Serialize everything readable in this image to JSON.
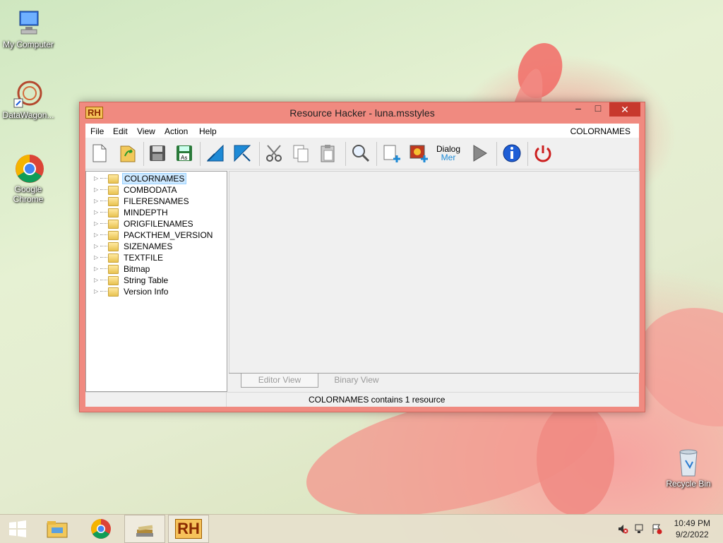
{
  "desktop": {
    "icons": [
      {
        "label": "My Computer"
      },
      {
        "label": "DataWagon..."
      },
      {
        "label": "Google Chrome"
      },
      {
        "label": "Recycle Bin"
      }
    ]
  },
  "window": {
    "logo": "RH",
    "title": "Resource Hacker - luna.msstyles",
    "menu": [
      "File",
      "Edit",
      "View",
      "Action",
      "Help"
    ],
    "menu_right": "COLORNAMES",
    "toolbar": [
      "new-file-icon",
      "open-file-icon",
      "save-icon",
      "save-as-icon",
      "back-arrow-icon",
      "forward-arrow-icon",
      "cut-icon",
      "copy-icon",
      "paste-icon",
      "find-icon",
      "add-resource-icon",
      "add-image-icon",
      "dialog-menu-icon",
      "compile-icon",
      "about-icon",
      "exit-icon"
    ],
    "toolbar_dialog_label": "Dialog",
    "toolbar_dialog_label2": "Mer",
    "toolbar_saveas_label": "As",
    "tree": [
      {
        "label": "COLORNAMES",
        "selected": true
      },
      {
        "label": "COMBODATA"
      },
      {
        "label": "FILERESNAMES"
      },
      {
        "label": "MINDEPTH"
      },
      {
        "label": "ORIGFILENAMES"
      },
      {
        "label": "PACKTHEM_VERSION"
      },
      {
        "label": "SIZENAMES"
      },
      {
        "label": "TEXTFILE"
      },
      {
        "label": "Bitmap"
      },
      {
        "label": "String Table"
      },
      {
        "label": "Version Info"
      }
    ],
    "tabs": [
      "Editor View",
      "Binary View"
    ],
    "status": "COLORNAMES contains 1 resource"
  },
  "taskbar": {
    "clock_time": "10:49 PM",
    "clock_date": "9/2/2022",
    "rh_label": "RH"
  }
}
